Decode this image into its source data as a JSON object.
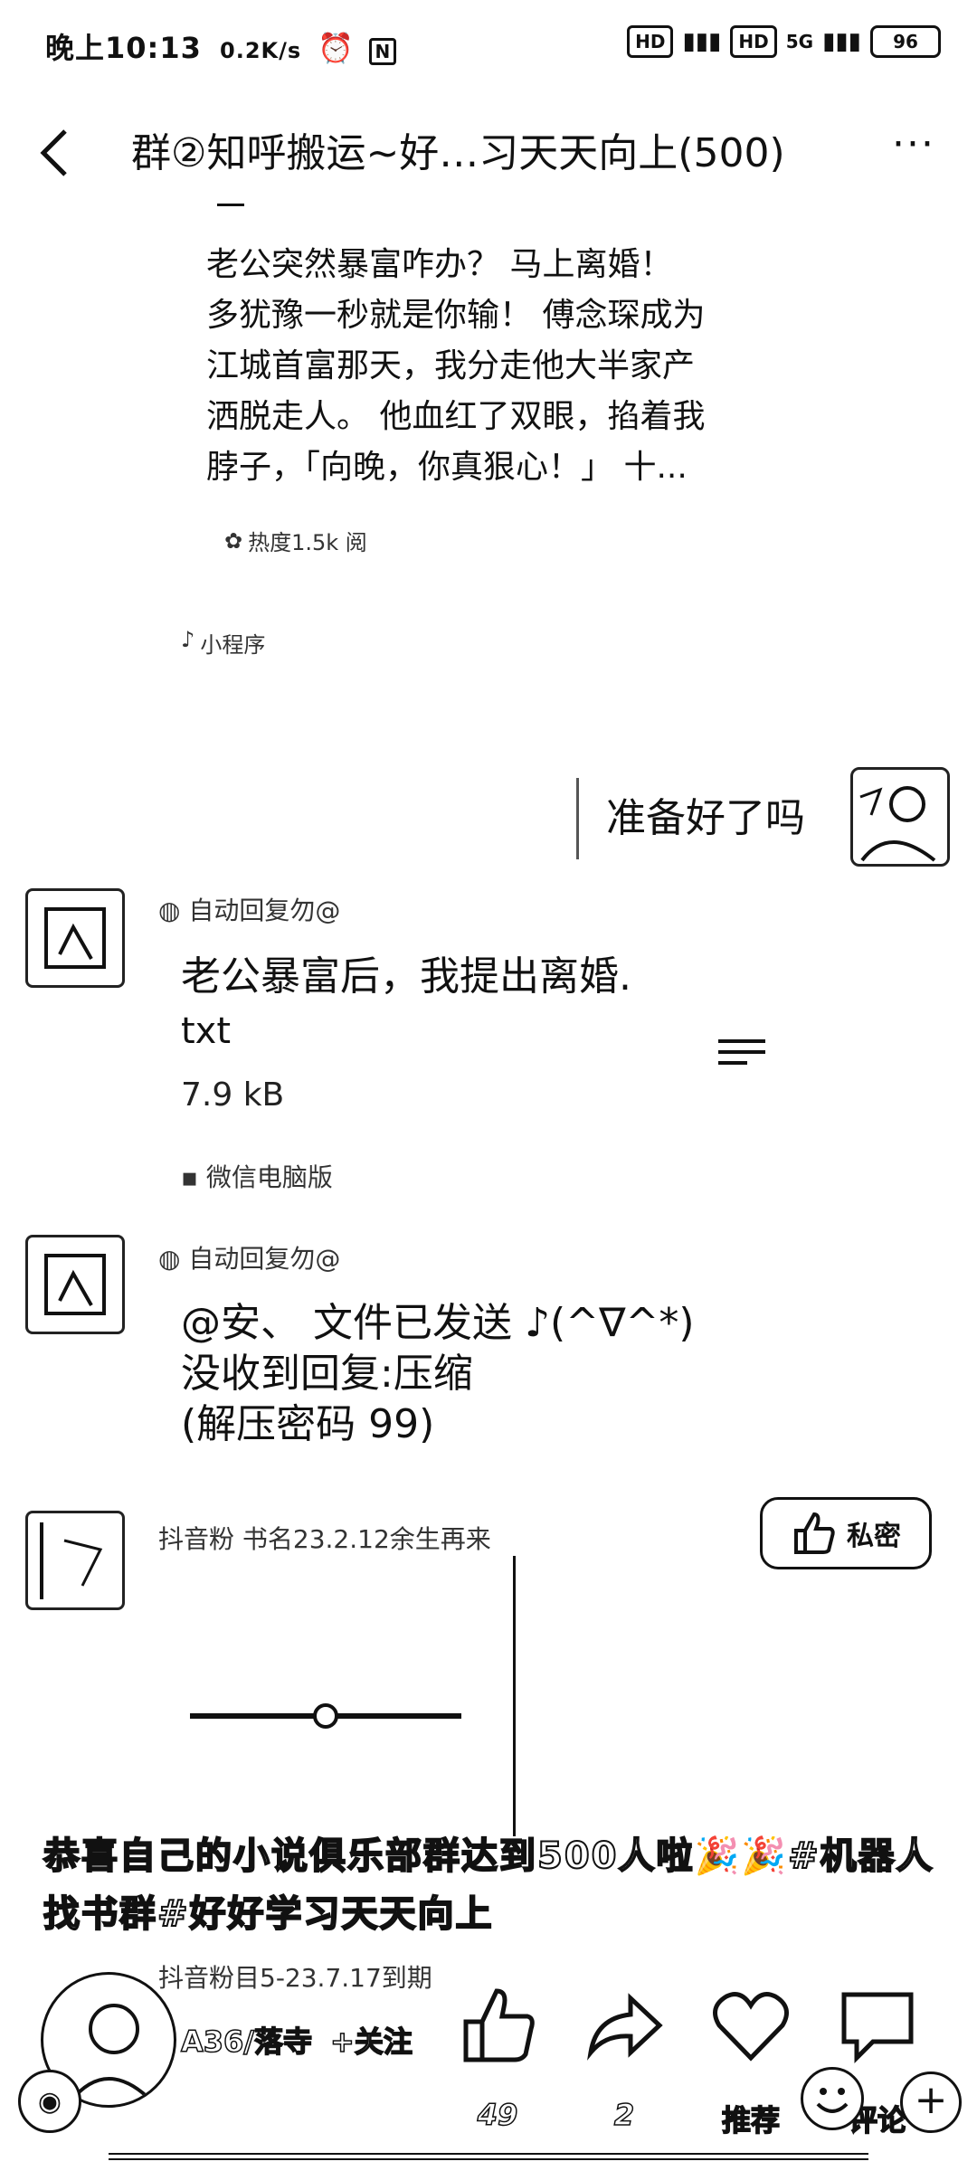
{
  "status_bar": {
    "time": "晚上10:13",
    "net_speed": "0.2K/s",
    "right_icons": [
      "HD",
      "HD",
      "5G",
      "96"
    ]
  },
  "header": {
    "title": "群②知呼搬运~好…习天天向上(500)",
    "back_icon": "chevron-left-icon",
    "more_icon": "more-horizontal-icon"
  },
  "story_card": {
    "lines": [
      "老公突然暴富咋办？ 马上离婚！",
      "多犹豫一秒就是你输！ 傅念琛成为",
      "江城首富那天，我分走他大半家产",
      "洒脱走人。 他血红了双眼，掐着我",
      "脖子，「向晚，你真狠心！」 十..."
    ],
    "meta": "热度1.5k 阅",
    "mini_label": "小程序"
  },
  "my_message": {
    "text": "准备好了吗"
  },
  "file_message": {
    "sender": "自动回复勿@",
    "file_name": "老公暴富后，我提出离婚.",
    "file_ext": "txt",
    "file_size": "7.9 kB",
    "source": "微信电脑版"
  },
  "reply_message": {
    "sender": "自动回复勿@",
    "lines": [
      "@安、 文件已发送 ♪(^∇^*)",
      "没收到回复:压缩",
      "(解压密码 99)"
    ]
  },
  "next_message": {
    "sender": "抖音粉 书名23.2.12余生再来",
    "button_label": "私密"
  },
  "caption": "恭喜自己的小说俱乐部群达到500人啦🎉🎉#机器人找书群#好好学习天天向上",
  "bottom_sender": "抖音粉目5-23.7.17到期",
  "bottom_bar": {
    "username": "A36/落寺",
    "follow_label": "+关注",
    "like_count": "49",
    "share_count": "2",
    "recommend_label": "推荐",
    "comment_label": "评论"
  }
}
